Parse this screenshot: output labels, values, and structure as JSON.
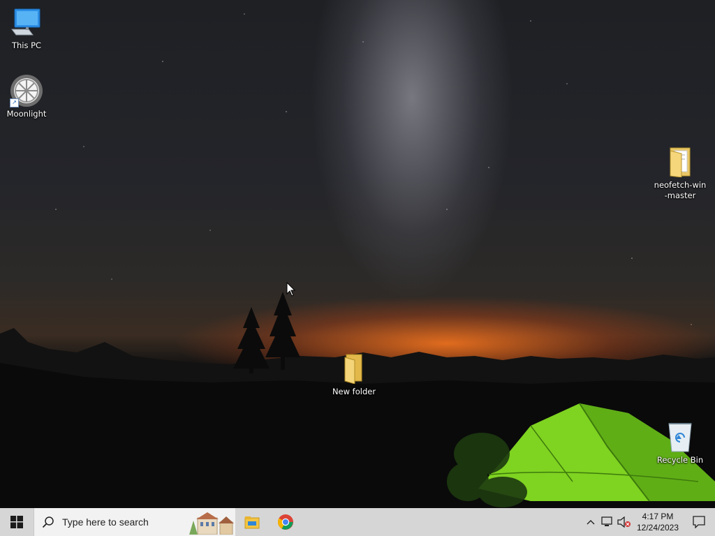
{
  "desktop": {
    "icons": {
      "this_pc": {
        "label": "This PC",
        "icon": "monitor-icon"
      },
      "moonlight": {
        "label": "Moonlight",
        "icon": "moonlight-app-icon"
      },
      "neofetch": {
        "label": "neofetch-win\n-master",
        "icon": "folder-icon"
      },
      "new_folder": {
        "label": "New folder",
        "icon": "folder-icon"
      },
      "recycle_bin": {
        "label": "Recycle Bin",
        "icon": "recycle-bin-icon"
      }
    }
  },
  "taskbar": {
    "search_placeholder": "Type here to search",
    "pinned": [
      {
        "name": "File Explorer",
        "icon": "file-explorer-icon"
      },
      {
        "name": "Google Chrome",
        "icon": "chrome-icon"
      }
    ],
    "clock": {
      "time": "4:17 PM",
      "date": "12/24/2023"
    }
  },
  "colors": {
    "taskbar_bg": "#d6d6d6",
    "search_bg": "#f2f2f2",
    "windows_blue": "#0078d4"
  }
}
